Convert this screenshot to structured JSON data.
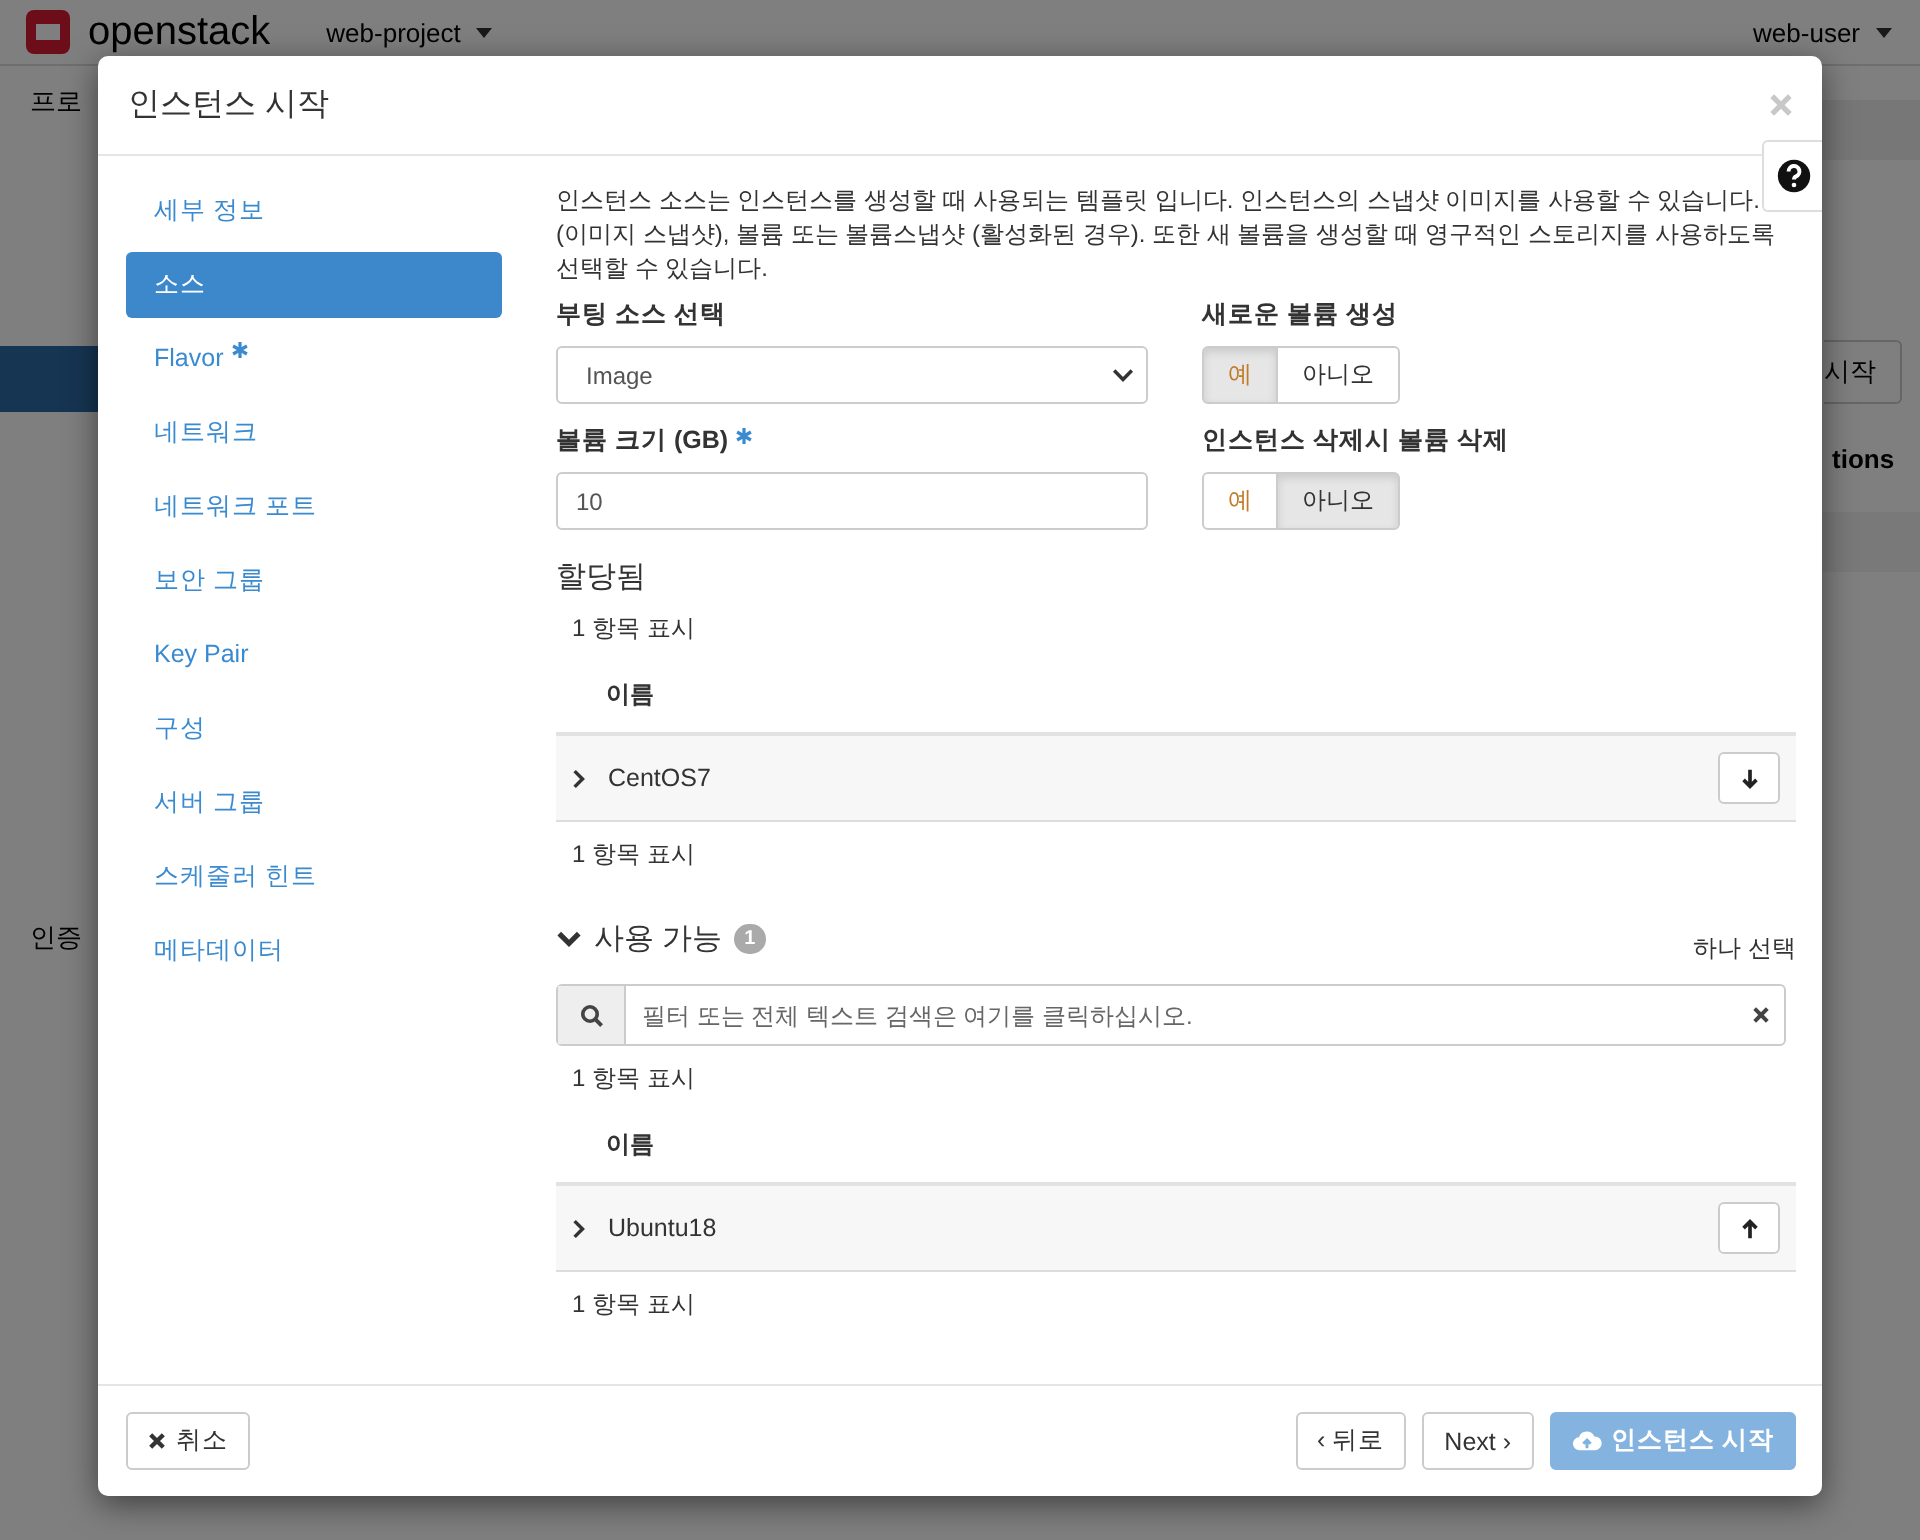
{
  "background": {
    "brand": "openstack",
    "project": "web-project",
    "user": "web-user",
    "breadcrumb": "프로",
    "action_button": "시작",
    "column_heading": "tions",
    "sidebar_item": "인증"
  },
  "modal": {
    "title": "인스턴스 시작",
    "steps": [
      {
        "label": "세부 정보",
        "required": false,
        "selected": false
      },
      {
        "label": "소스",
        "required": false,
        "selected": true
      },
      {
        "label": "Flavor",
        "required": true,
        "selected": false
      },
      {
        "label": "네트워크",
        "required": false,
        "selected": false
      },
      {
        "label": "네트워크 포트",
        "required": false,
        "selected": false
      },
      {
        "label": "보안 그룹",
        "required": false,
        "selected": false
      },
      {
        "label": "Key Pair",
        "required": false,
        "selected": false
      },
      {
        "label": "구성",
        "required": false,
        "selected": false
      },
      {
        "label": "서버 그룹",
        "required": false,
        "selected": false
      },
      {
        "label": "스케줄러 힌트",
        "required": false,
        "selected": false
      },
      {
        "label": "메타데이터",
        "required": false,
        "selected": false
      }
    ],
    "description": "인스턴스 소스는 인스턴스를 생성할 때 사용되는 템플릿 입니다. 인스턴스의 스냅샷 이미지를 사용할 수 있습니다. (이미지 스냅샷), 볼륨 또는 볼륨스냅샷 (활성화된 경우). 또한 새 볼륨을 생성할 때 영구적인 스토리지를 사용하도록 선택할 수 있습니다.",
    "boot_source": {
      "label": "부팅 소스 선택",
      "value": "Image"
    },
    "new_volume": {
      "label": "새로운 볼륨 생성",
      "options": [
        {
          "label": "예",
          "selected": true
        },
        {
          "label": "아니오",
          "selected": false
        }
      ]
    },
    "volume_size": {
      "label": "볼륨 크기 (GB)",
      "required": true,
      "value": "10"
    },
    "delete_volume": {
      "label": "인스턴스 삭제시 볼륨 삭제",
      "options": [
        {
          "label": "예",
          "selected": false
        },
        {
          "label": "아니오",
          "selected": true
        }
      ]
    },
    "allocated": {
      "title": "할당됨",
      "count_top": "1 항목 표시",
      "column": "이름",
      "rows": [
        {
          "name": "CentOS7"
        }
      ],
      "count_bottom": "1 항목 표시"
    },
    "available": {
      "title": "사용 가능",
      "expanded": true,
      "badge": "1",
      "note": "하나 선택",
      "search_placeholder": "필터 또는 전체 텍스트 검색은 여기를 클릭하십시오.",
      "count_top": "1 항목 표시",
      "column": "이름",
      "rows": [
        {
          "name": "Ubuntu18"
        }
      ],
      "count_bottom": "1 항목 표시"
    },
    "footer": {
      "cancel": "취소",
      "back": "‹ 뒤로",
      "next": "Next ›",
      "launch": "인스턴스 시작",
      "launch_disabled": true
    }
  }
}
